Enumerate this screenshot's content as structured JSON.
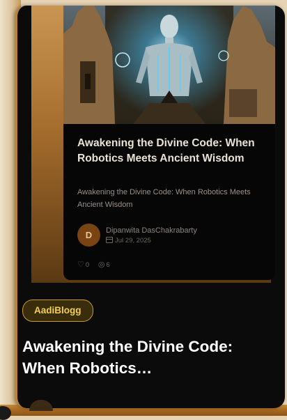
{
  "post_preview": {
    "title": "Awakening the Divine Code: When Robotics Meets Ancient Wisdom",
    "description": "Awakening the Divine Code: When Robotics Meets Ancient Wisdom",
    "author": {
      "initial": "D",
      "name": "Dipanwita DasChakrabarty",
      "date": "Jul 29, 2025"
    },
    "likes": "0",
    "views": "6",
    "icons": {
      "calendar": "calendar-icon",
      "like": "heart-icon",
      "views": "eye-icon"
    }
  },
  "category_badge": "AadiBlogg",
  "main_title": "Awakening the Divine Code: When Robotics…",
  "colors": {
    "badge_text": "#f1cf55",
    "badge_border": "#c69b2a",
    "card_bg": "#0b0b0b",
    "frame": "#b9843a"
  }
}
